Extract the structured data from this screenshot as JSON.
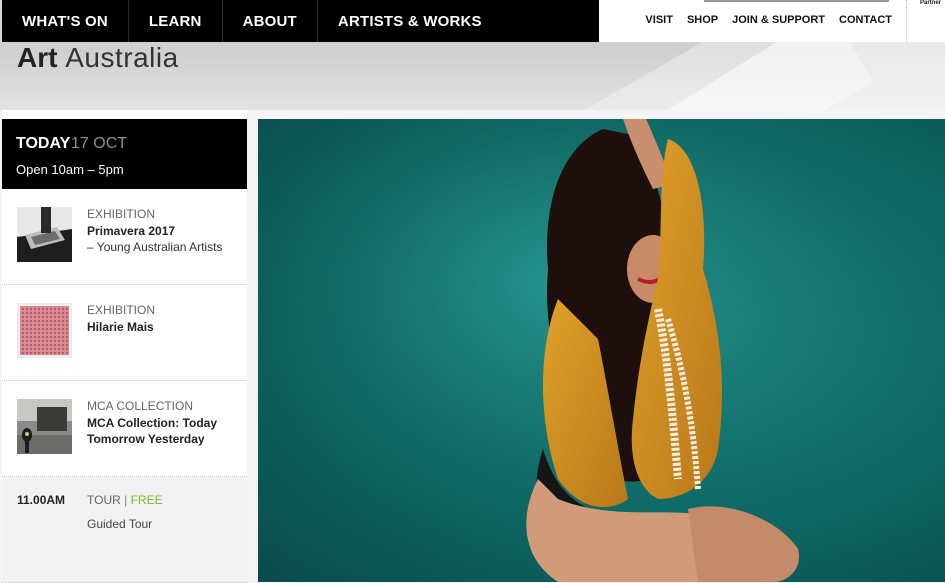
{
  "primary_nav": [
    {
      "label": "WHAT'S ON"
    },
    {
      "label": "LEARN"
    },
    {
      "label": "ABOUT"
    },
    {
      "label": "ARTISTS & WORKS"
    }
  ],
  "utility_nav": [
    {
      "label": "VISIT"
    },
    {
      "label": "SHOP"
    },
    {
      "label": "JOIN & SUPPORT"
    },
    {
      "label": "CONTACT"
    }
  ],
  "partner_label": "Partner",
  "logo": {
    "bold": "Art",
    "light": "Australia"
  },
  "today": {
    "label": "TODAY",
    "date": "17 OCT",
    "hours": "Open 10am – 5pm"
  },
  "events": [
    {
      "category": "EXHIBITION",
      "title": "Primavera 2017",
      "subtitle": "– Young Australian Artists",
      "thumb_icon": "exhibition-thumbnail"
    },
    {
      "category": "EXHIBITION",
      "title": "Hilarie Mais",
      "subtitle": "",
      "thumb_icon": "pink-textile-thumbnail"
    },
    {
      "category": "MCA COLLECTION",
      "title": "MCA Collection: Today",
      "subtitle": "Tomorrow Yesterday",
      "thumb_icon": "gallery-room-thumbnail"
    }
  ],
  "tour": {
    "time": "11.00AM",
    "category": "TOUR",
    "separator": "|",
    "price": "FREE",
    "name": "Guided Tour"
  },
  "colors": {
    "accent_free": "#7bb928",
    "nav_bg": "#000000",
    "hero_bg": "#127671"
  }
}
